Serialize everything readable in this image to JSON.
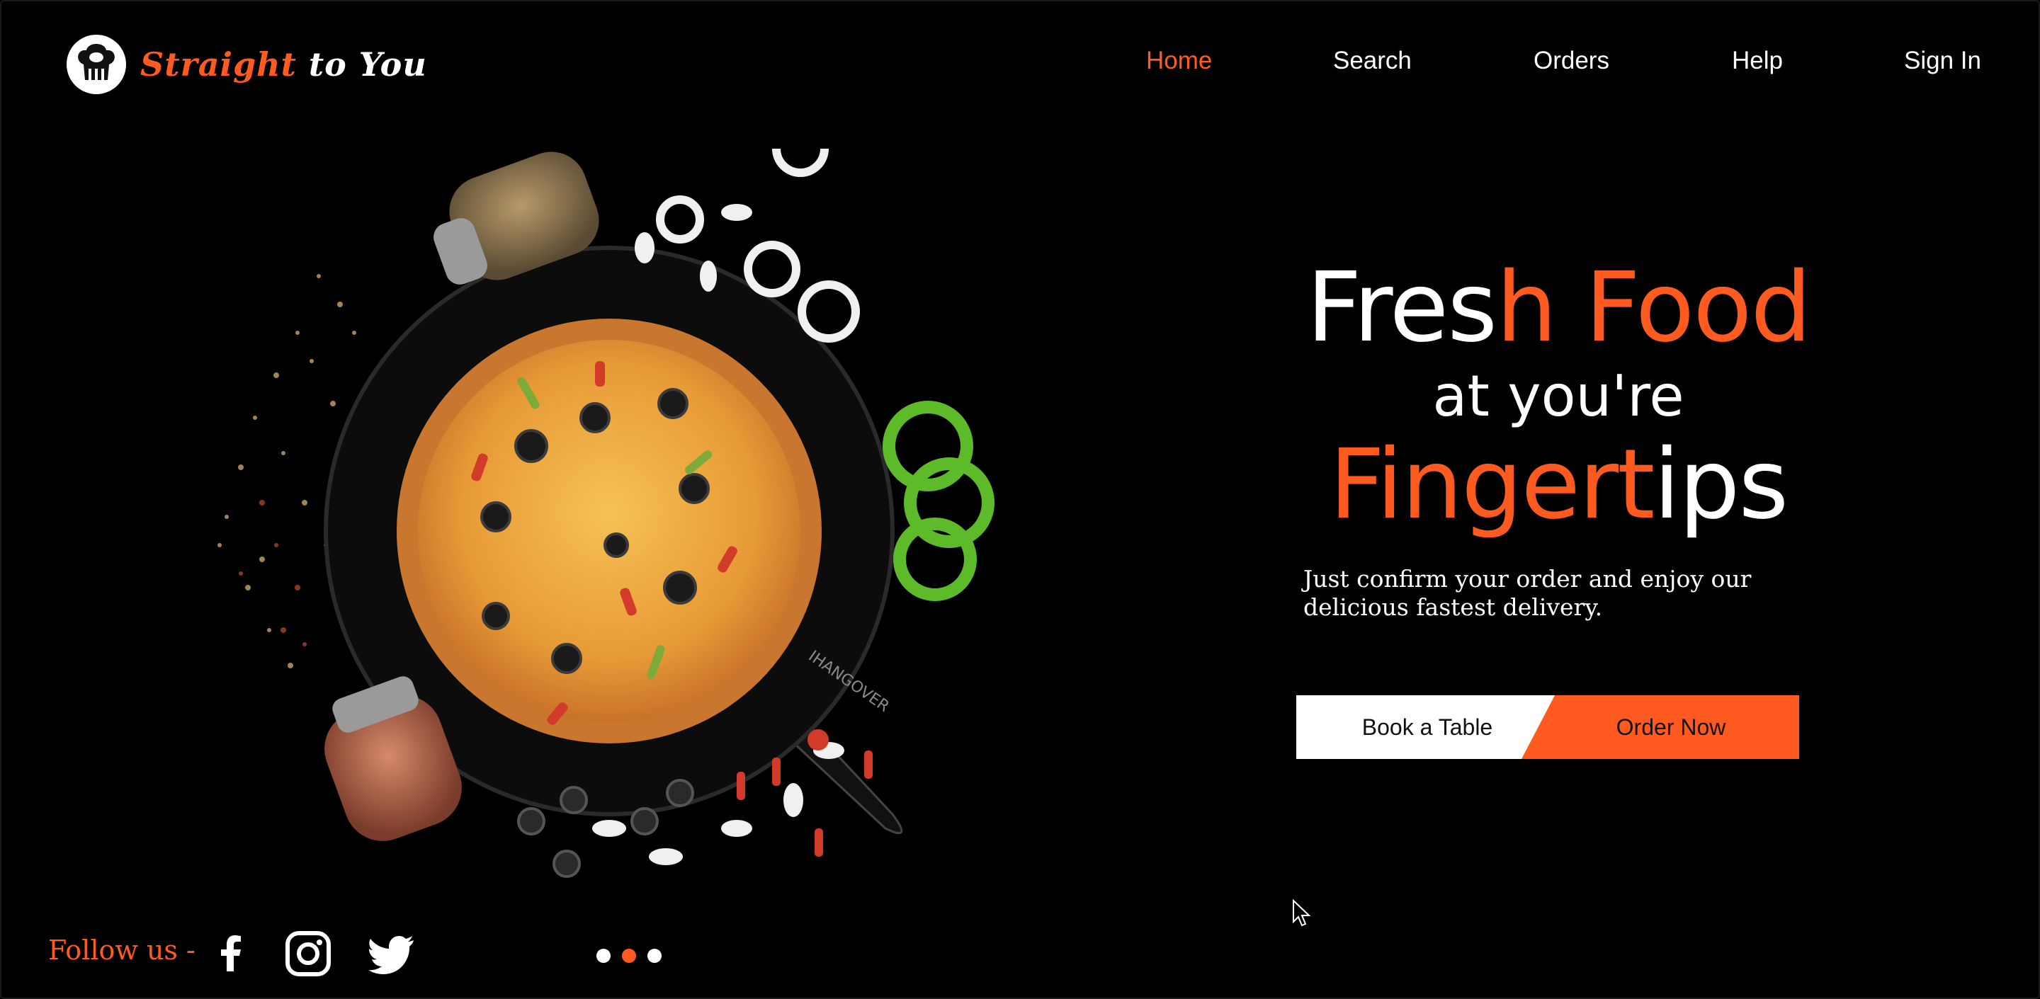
{
  "brand": {
    "part1": "Straight",
    "part2": "to You"
  },
  "nav": {
    "items": [
      {
        "label": "Home",
        "active": true
      },
      {
        "label": "Search",
        "active": false
      },
      {
        "label": "Orders",
        "active": false
      },
      {
        "label": "Help",
        "active": false
      },
      {
        "label": "Sign In",
        "active": false
      }
    ]
  },
  "hero": {
    "line1_part1": "Fres",
    "line1_part2": "h Food",
    "line2": "at you're",
    "line3_part1": "Fingert",
    "line3_part2": "ips",
    "tagline": "Just confirm your order and enjoy our delicious fastest delivery.",
    "book_label": "Book a Table",
    "order_label": "Order Now",
    "pan_brand": "IHANGOVER"
  },
  "footer": {
    "follow_label": "Follow us -",
    "social": [
      "facebook-icon",
      "instagram-icon",
      "twitter-icon"
    ]
  },
  "carousel": {
    "count": 3,
    "active_index": 1
  },
  "colors": {
    "accent": "#ff5a1f",
    "background": "#000000",
    "text": "#ffffff"
  }
}
